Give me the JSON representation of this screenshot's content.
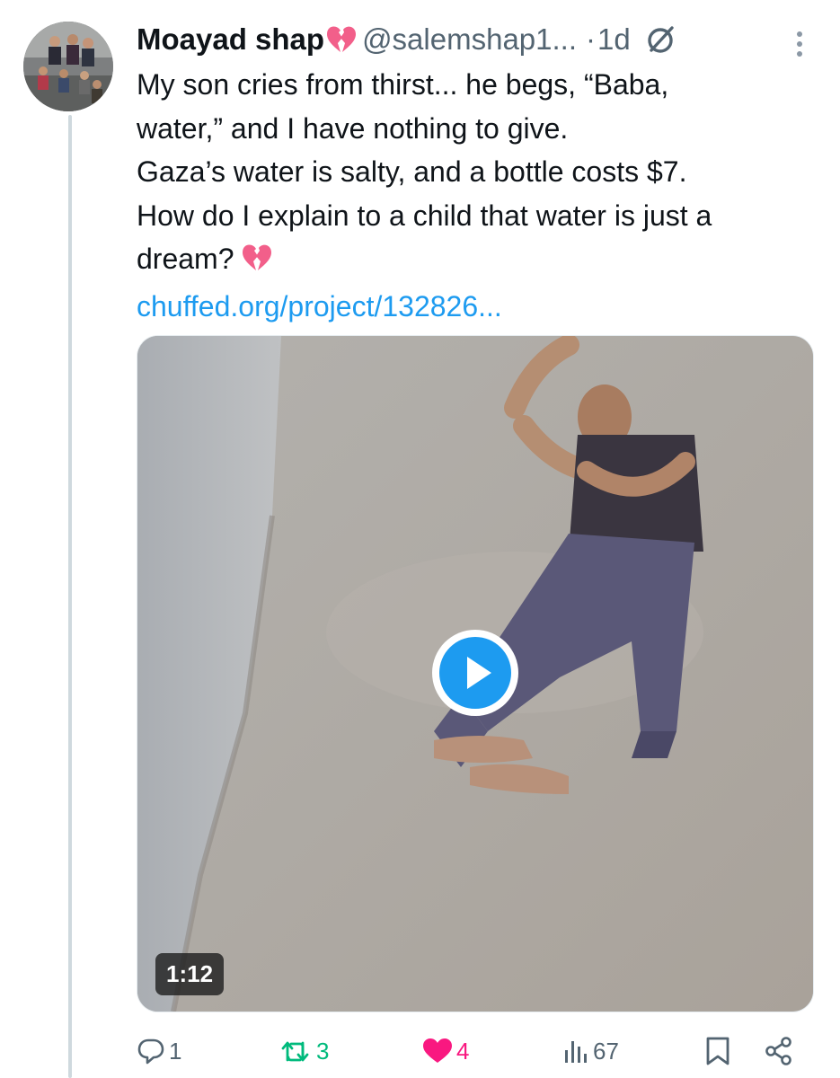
{
  "user": {
    "display_name": "Moayad shap",
    "handle": "@salemshap1...",
    "separator": "·",
    "time": "1d"
  },
  "tweet": {
    "lines": [
      "My son cries from thirst... he begs, “Baba,",
      "water,” and I have nothing to give.",
      "Gaza’s water is salty, and a bottle costs $7.",
      "How do I explain to a child that water is just a"
    ],
    "last_line": "dream?",
    "link": "chuffed.org/project/132826..."
  },
  "media": {
    "duration": "1:12"
  },
  "actions": {
    "reply_count": "1",
    "retweet_count": "3",
    "like_count": "4",
    "views_count": "67"
  },
  "colors": {
    "link": "#1d9bf0",
    "retweet_active": "#00ba7c",
    "like_active": "#f91880",
    "secondary_text": "#536471",
    "play_button": "#1d9bf0"
  },
  "icons": {
    "header": [
      "broken-heart-emoji",
      "verified-badge-icon",
      "more-options-icon"
    ],
    "media": [
      "play-icon"
    ],
    "actions": [
      "reply-icon",
      "retweet-icon",
      "like-heart-icon",
      "views-chart-icon",
      "bookmark-icon",
      "share-icon"
    ]
  }
}
